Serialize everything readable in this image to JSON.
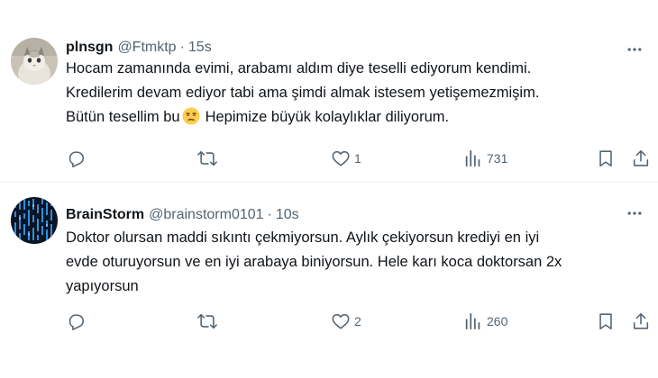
{
  "tweets": [
    {
      "display_name": "plnsgn",
      "handle": "@Ftmktp",
      "separator": "·",
      "time": "15s",
      "text_lines": [
        "Hocam zamanında evimi, arabamı aldım diye teselli ediyorum kendimi.",
        "Kredilerim devam ediyor tabi ama şimdi almak istesem yetişemezmişim.",
        "Bütün tesellim bu"
      ],
      "text_after_emoji": "Hepimize büyük kolaylıklar diliyorum.",
      "emoji": "unamused-face-emoji",
      "likes": "1",
      "views": "731",
      "reposts": "",
      "replies": ""
    },
    {
      "display_name": "BrainStorm",
      "handle": "@brainstorm0101",
      "separator": "·",
      "time": "10s",
      "text_lines": [
        "Doktor olursan maddi sıkıntı çekmiyorsun. Aylık çekiyorsun krediyi en iyi",
        "evde oturuyorsun ve en iyi arabaya biniyorsun. Hele karı koca doktorsan 2x",
        "yapıyorsun"
      ],
      "likes": "2",
      "views": "260",
      "reposts": "",
      "replies": ""
    }
  ],
  "icons": {
    "more": "more-horizontal-icon",
    "reply": "reply-icon",
    "repost": "repost-icon",
    "like": "heart-icon",
    "views": "views-icon",
    "bookmark": "bookmark-icon",
    "share": "share-icon"
  },
  "colors": {
    "text": "#0f1419",
    "secondary": "#536471",
    "divider": "#eff3f4"
  }
}
